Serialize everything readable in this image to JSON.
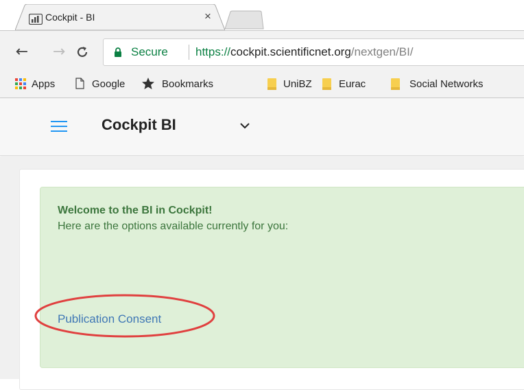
{
  "browser": {
    "tab_title": "Cockpit - BI",
    "tab_close": "×",
    "secure_label": "Secure",
    "url_scheme": "https://",
    "url_host": "cockpit.scientificnet.org",
    "url_path": "/nextgen/BI/"
  },
  "bookmarks": [
    {
      "label": "Apps",
      "icon": "apps-grid-icon"
    },
    {
      "label": "Google",
      "icon": "page-icon"
    },
    {
      "label": "Bookmarks",
      "icon": "star-icon"
    },
    {
      "label": "UniBZ",
      "icon": "folder-icon"
    },
    {
      "label": "Eurac",
      "icon": "folder-icon"
    },
    {
      "label": "Social Networks",
      "icon": "folder-icon"
    }
  ],
  "app": {
    "brand": "Cockpit BI"
  },
  "alert": {
    "title": "Welcome to the BI in Cockpit!",
    "text": "Here are the options available currently for you:",
    "link": "Publication Consent"
  },
  "colors": {
    "accent": "#2196f3",
    "alert_bg": "#dff0d8",
    "alert_text": "#3c763d",
    "link": "#3f77b5",
    "secure": "#0b8043",
    "highlight": "#e0403f"
  }
}
